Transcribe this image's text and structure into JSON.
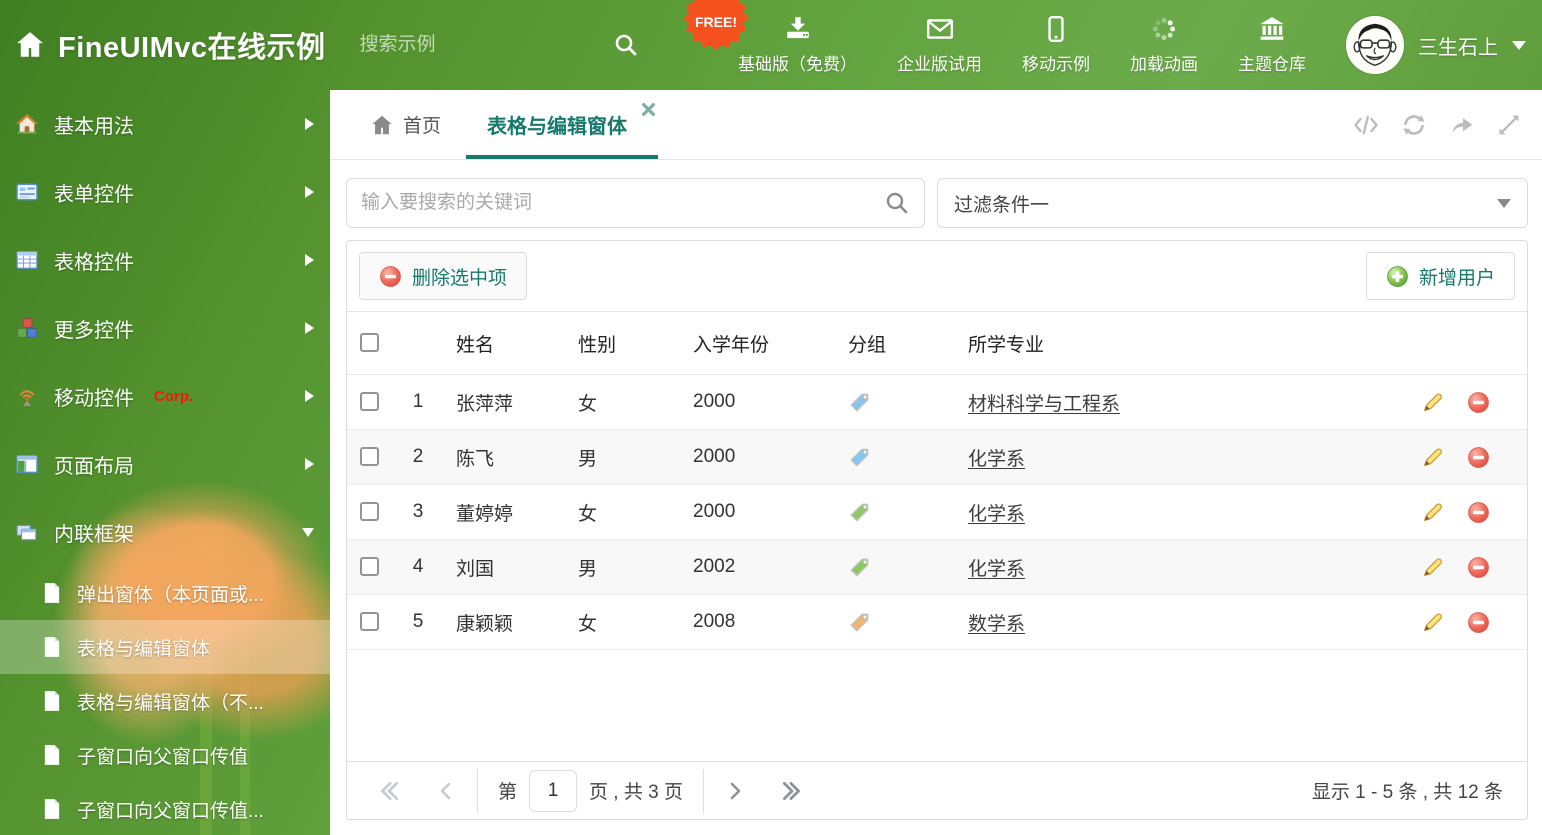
{
  "colors": {
    "accent_teal": "#17796b",
    "header_green": "#57992f",
    "free_badge_orange": "#f4511e",
    "corp_red": "#ff140a",
    "tag_blue": "#85c6ee",
    "tag_green": "#8cc963",
    "tag_orange": "#f6b26f",
    "link_gray": "#3d3d3d"
  },
  "header": {
    "title": "FineUIMvc在线示例",
    "search_placeholder": "搜索示例",
    "free_badge": "FREE!",
    "nav": [
      {
        "label": "基础版（免费）",
        "icon": "download-icon"
      },
      {
        "label": "企业版试用",
        "icon": "envelope-icon"
      },
      {
        "label": "移动示例",
        "icon": "phone-icon"
      },
      {
        "label": "加载动画",
        "icon": "spinner-icon"
      },
      {
        "label": "主题仓库",
        "icon": "bank-icon"
      }
    ],
    "user": {
      "name": "三生石上"
    }
  },
  "sidebar": {
    "items": [
      {
        "label": "基本用法",
        "icon": "home-icon"
      },
      {
        "label": "表单控件",
        "icon": "form-icon"
      },
      {
        "label": "表格控件",
        "icon": "table-icon"
      },
      {
        "label": "更多控件",
        "icon": "cubes-icon"
      },
      {
        "label": "移动控件",
        "badge": "Corp.",
        "icon": "antenna-icon"
      },
      {
        "label": "页面布局",
        "icon": "layout-icon"
      },
      {
        "label": "内联框架",
        "icon": "frames-icon",
        "expanded": true
      }
    ],
    "subitems": [
      {
        "label": "弹出窗体（本页面或..."
      },
      {
        "label": "表格与编辑窗体",
        "active": true
      },
      {
        "label": "表格与编辑窗体（不..."
      },
      {
        "label": "子窗口向父窗口传值"
      },
      {
        "label": "子窗口向父窗口传值..."
      }
    ]
  },
  "tabbar": {
    "tabs": [
      {
        "label": "首页",
        "icon": "home-icon"
      },
      {
        "label": "表格与编辑窗体",
        "active": true,
        "closable": true
      }
    ],
    "tools": [
      "code-icon",
      "refresh-icon",
      "share-icon",
      "expand-icon"
    ]
  },
  "filters": {
    "search_placeholder": "输入要搜索的关键词",
    "filter_selected": "过滤条件一"
  },
  "grid": {
    "toolbar": {
      "delete_label": "删除选中项",
      "add_label": "新增用户"
    },
    "columns": [
      "姓名",
      "性别",
      "入学年份",
      "分组",
      "所学专业"
    ],
    "rows": [
      {
        "num": "1",
        "name": "张萍萍",
        "gender": "女",
        "year": "2000",
        "tag_color": "#85c6ee",
        "major": "材料科学与工程系"
      },
      {
        "num": "2",
        "name": "陈飞",
        "gender": "男",
        "year": "2000",
        "tag_color": "#85c6ee",
        "major": "化学系"
      },
      {
        "num": "3",
        "name": "董婷婷",
        "gender": "女",
        "year": "2000",
        "tag_color": "#8cc963",
        "major": "化学系"
      },
      {
        "num": "4",
        "name": "刘国",
        "gender": "男",
        "year": "2002",
        "tag_color": "#8cc963",
        "major": "化学系"
      },
      {
        "num": "5",
        "name": "康颖颖",
        "gender": "女",
        "year": "2008",
        "tag_color": "#f6b26f",
        "major": "数学系"
      }
    ],
    "pager": {
      "prefix": "第",
      "page_value": "1",
      "suffix": "页 , 共 3 页",
      "summary": "显示 1 - 5 条 , 共 12 条"
    }
  }
}
